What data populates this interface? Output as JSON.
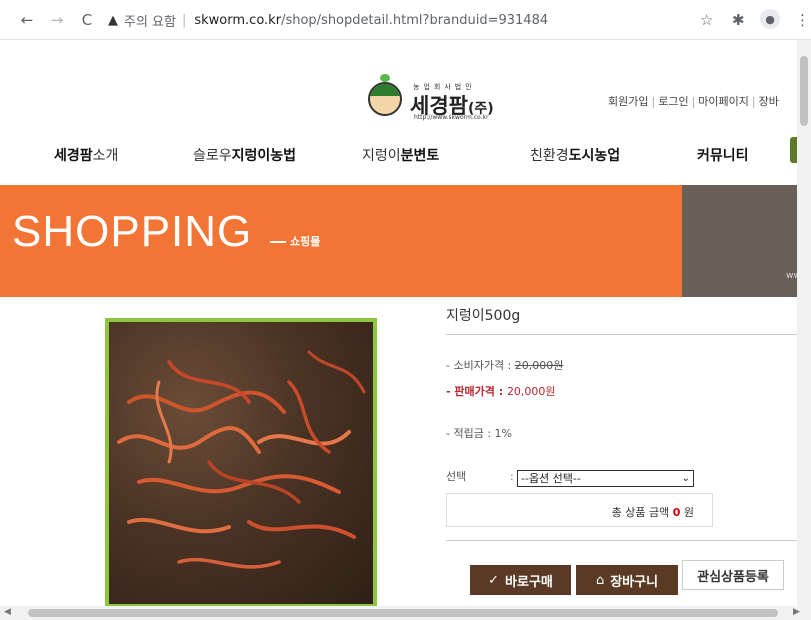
{
  "browser": {
    "security_label": "주의 요함",
    "url_host": "skworm.co.kr",
    "url_path": "/shop/shopdetail.html?branduid=931484"
  },
  "header": {
    "logo_small": "농업회사법인",
    "logo_name": "세경팜",
    "logo_suffix": "(주)",
    "logo_url": "http://www.skworm.co.kr",
    "links": [
      "회원가입",
      "로그인",
      "마이페이지",
      "장바"
    ]
  },
  "gnb": [
    {
      "pre": "세경팜",
      "post": "소개"
    },
    {
      "pre": "슬로우",
      "post": "지렁이농법"
    },
    {
      "pre": "지렁이",
      "post": "분변토"
    },
    {
      "pre": "친환경",
      "post": "도시농업"
    },
    {
      "pre": "",
      "post": "커뮤니티"
    }
  ],
  "banner": {
    "title": "SHOPPING",
    "subtitle": "쇼핑몰",
    "right_text": "ww"
  },
  "product": {
    "name": "지렁이500g",
    "consumer_price_label": "- 소비자가격 : ",
    "consumer_price": "20,000원",
    "sale_price_label": "- 판매가격 : ",
    "sale_price": "20,000원",
    "points": "- 적립금 : 1%",
    "option_label": "선택",
    "option_colon": ":",
    "option_selected": "--옵션 선택--",
    "total_label": "총 상품 금액",
    "total_value": "0",
    "total_unit": "원"
  },
  "buttons": {
    "buy": "바로구매",
    "cart": "장바구니",
    "wish": "관심상품등록"
  },
  "colors": {
    "banner_orange": "#f37536",
    "banner_dark": "#6a5e58",
    "button_brown": "#5a3a24",
    "image_border": "#8bc63e",
    "sale_red": "#b7272f"
  }
}
